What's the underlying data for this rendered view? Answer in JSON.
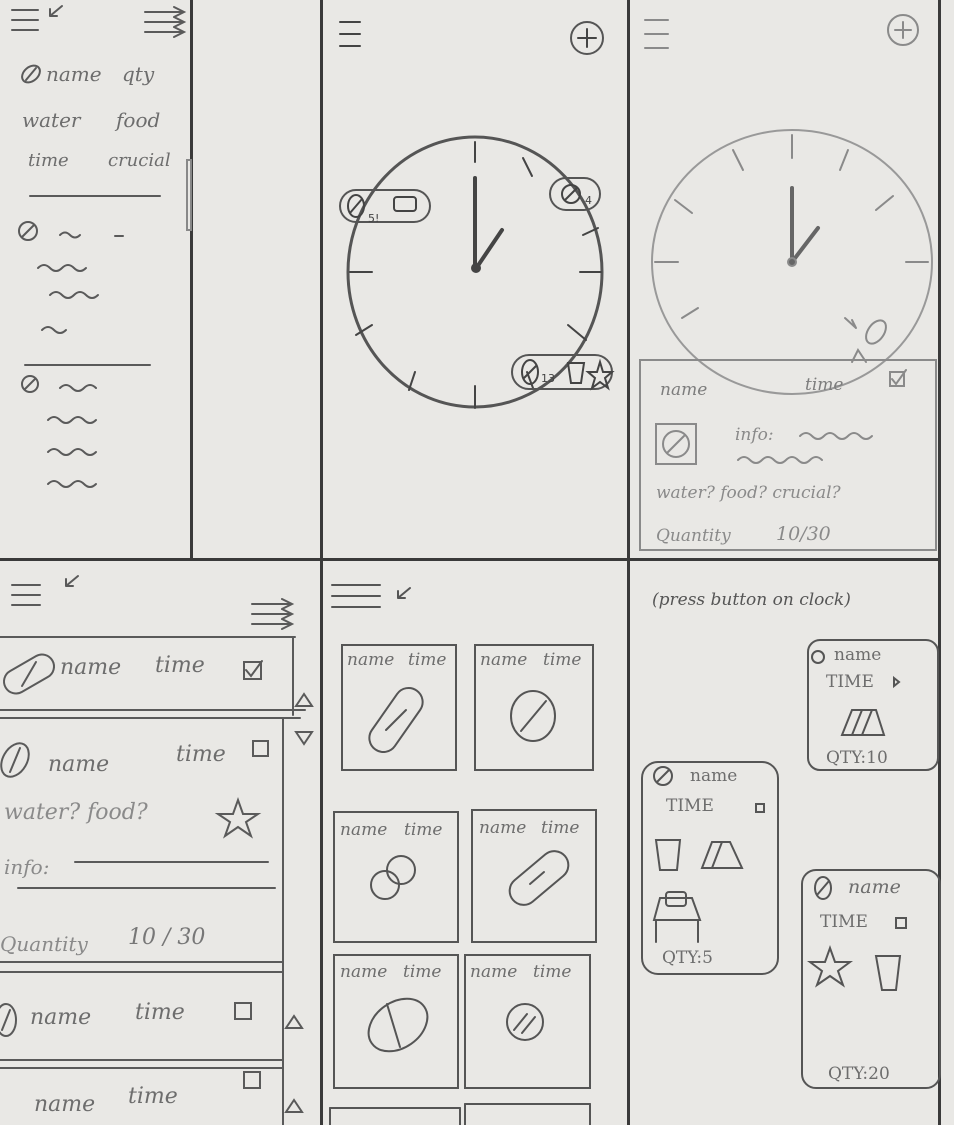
{
  "panel1": {
    "header": [
      "name",
      "qty",
      "water",
      "food",
      "time",
      "crucial"
    ]
  },
  "panel3": {
    "card": {
      "name": "name",
      "time": "time",
      "info": "info:",
      "flags": "water? food? crucial?",
      "quantity_label": "Quantity",
      "quantity_value": "10/30"
    }
  },
  "panel4": {
    "rows": [
      {
        "name": "name",
        "time": "time"
      },
      {
        "name": "name",
        "time": "time",
        "flags": "water? food?",
        "info": "info:",
        "quantity_label": "Quantity",
        "quantity_value": "10 / 30"
      },
      {
        "name": "name",
        "time": "time"
      },
      {
        "name": "name",
        "time": "time"
      }
    ]
  },
  "panel5": {
    "tiles": [
      {
        "name": "name",
        "time": "time"
      },
      {
        "name": "name",
        "time": "time"
      },
      {
        "name": "name",
        "time": "time"
      },
      {
        "name": "name",
        "time": "time"
      },
      {
        "name": "name",
        "time": "time"
      },
      {
        "name": "name",
        "time": "time"
      }
    ]
  },
  "panel6": {
    "note": "(press button on clock)",
    "cards": [
      {
        "name": "name",
        "time": "TIME",
        "qty": "QTY:10"
      },
      {
        "name": "name",
        "time": "TIME",
        "qty": "QTY:5"
      },
      {
        "name": "name",
        "time": "TIME",
        "qty": "QTY:20"
      }
    ]
  }
}
